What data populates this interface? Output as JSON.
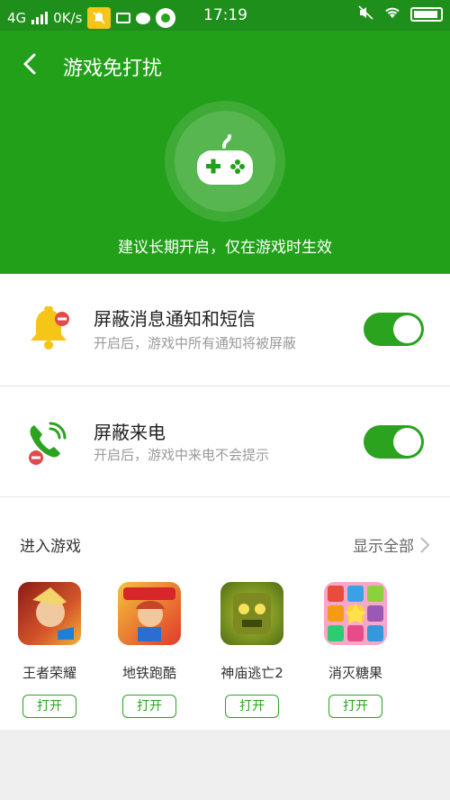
{
  "statusbar": {
    "network": "4G",
    "speed": "0K/s",
    "time": "17:19"
  },
  "header": {
    "title": "游戏免打扰",
    "subtitle": "建议长期开启，仅在游戏时生效"
  },
  "settings": [
    {
      "title": "屏蔽消息通知和短信",
      "subtitle": "开启后，游戏中所有通知将被屏蔽",
      "enabled": true,
      "icon": "bell-icon",
      "color": "#f5c518"
    },
    {
      "title": "屏蔽来电",
      "subtitle": "开启后，游戏中来电不会提示",
      "enabled": true,
      "icon": "phone-icon",
      "color": "#2aa31f"
    }
  ],
  "games": {
    "heading": "进入游戏",
    "show_all": "显示全部",
    "items": [
      {
        "name": "王者荣耀",
        "button": "打开",
        "color": "#b52a1f"
      },
      {
        "name": "地铁跑酷",
        "button": "打开",
        "color": "#d9332a"
      },
      {
        "name": "神庙逃亡2",
        "button": "打开",
        "color": "#6b8f1a"
      },
      {
        "name": "消灭糖果",
        "button": "打开",
        "color": "#e84a8a"
      }
    ]
  },
  "colors": {
    "primary": "#23a01a",
    "statusbar": "#1f8f1b",
    "accent": "#2aa31f"
  }
}
